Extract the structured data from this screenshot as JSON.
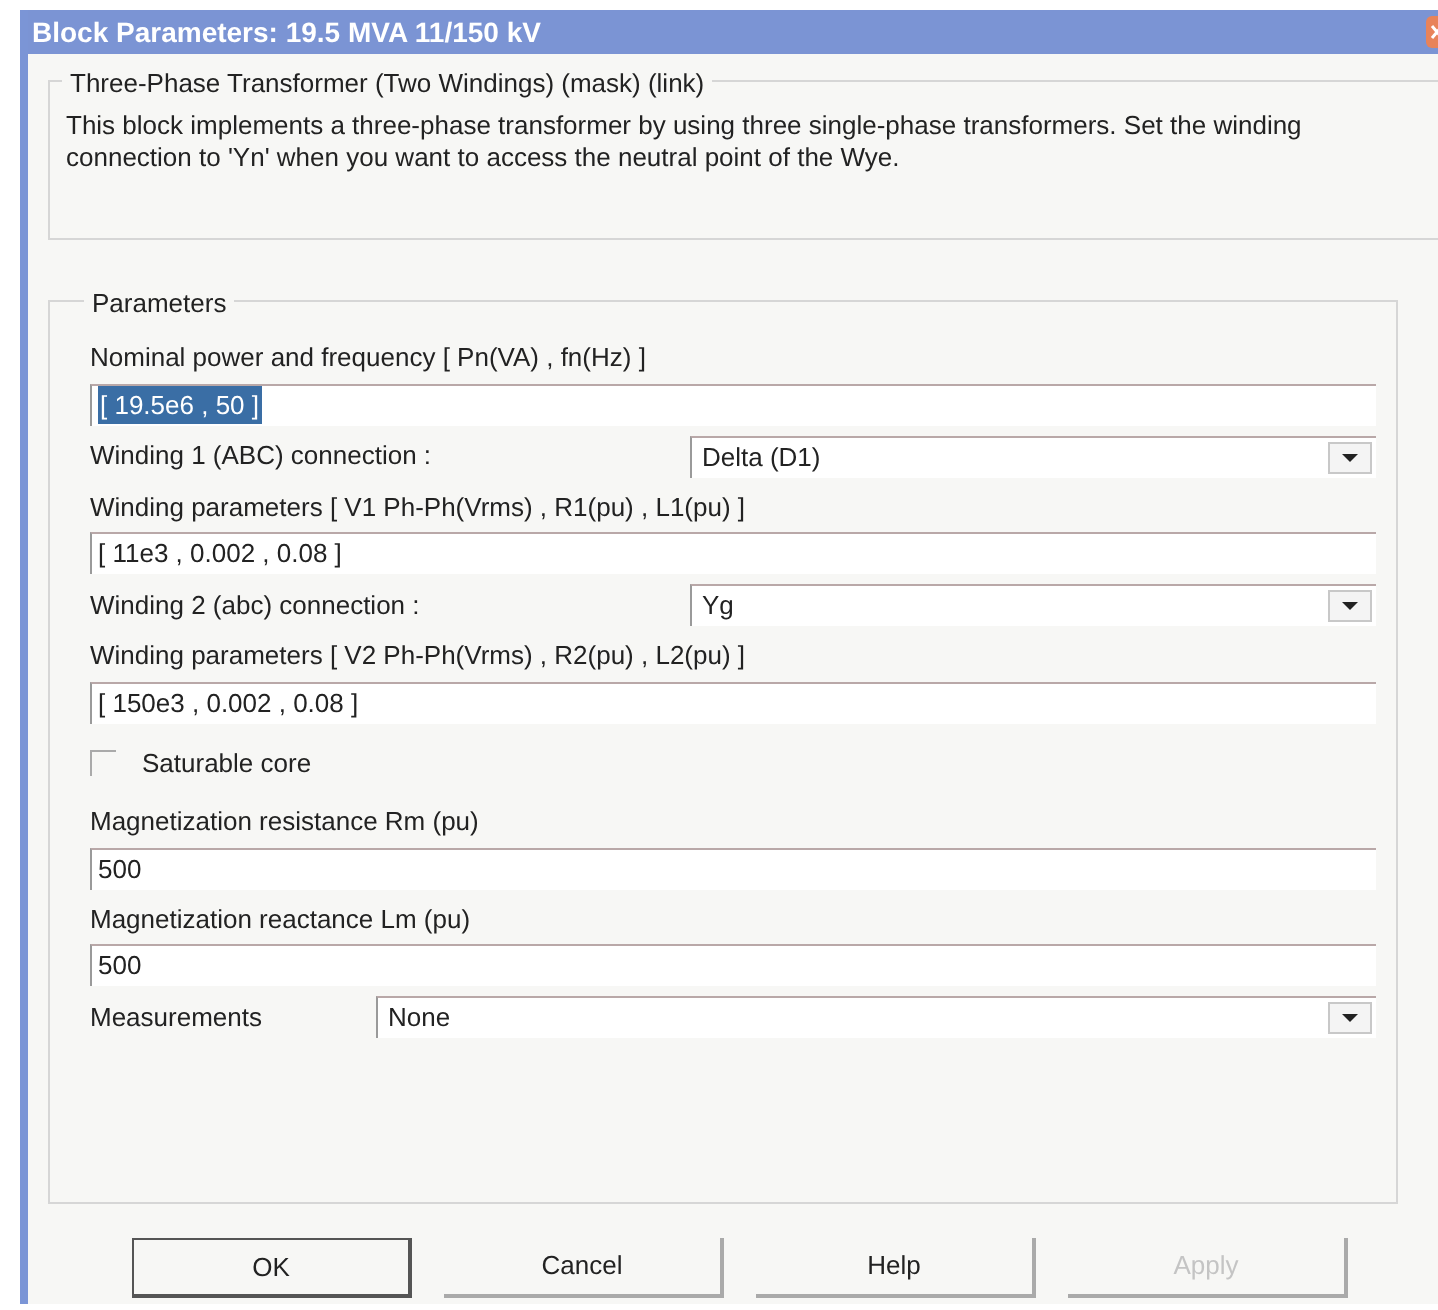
{
  "window": {
    "title": "Block Parameters: 19.5 MVA 11/150 kV"
  },
  "description": {
    "heading": "Three-Phase Transformer (Two Windings) (mask) (link)",
    "text": "This block implements a three-phase transformer by using three single-phase transformers. Set the winding connection to 'Yn'  when you want to access the neutral point of the Wye."
  },
  "parameters": {
    "heading": "Parameters",
    "fields": [
      {
        "kind": "text",
        "label": "Nominal power and frequency  [ Pn(VA) , fn(Hz) ]",
        "value": "[ 19.5e6 , 50 ]",
        "selected": true
      },
      {
        "kind": "dropdown",
        "label": "Winding 1 (ABC) connection :",
        "value": "Delta (D1)"
      },
      {
        "kind": "text",
        "label": "Winding parameters [ V1 Ph-Ph(Vrms) , R1(pu) , L1(pu) ]",
        "value": "[ 11e3 , 0.002 , 0.08 ]",
        "selected": false
      },
      {
        "kind": "dropdown",
        "label": "Winding 2 (abc) connection :",
        "value": "Yg"
      },
      {
        "kind": "text",
        "label": "Winding parameters [ V2 Ph-Ph(Vrms) , R2(pu) , L2(pu) ]",
        "value": "[ 150e3 , 0.002 , 0.08 ]",
        "selected": false
      },
      {
        "kind": "checkbox",
        "label": "Saturable core",
        "checked": false
      },
      {
        "kind": "text",
        "label": "Magnetization resistance  Rm (pu)",
        "value": "500",
        "selected": false
      },
      {
        "kind": "text",
        "label": "Magnetization reactance Lm (pu)",
        "value": "500",
        "selected": false
      },
      {
        "kind": "measure",
        "label": "Measurements",
        "value": "None"
      }
    ]
  },
  "buttons": [
    {
      "label": "OK",
      "disabled": false
    },
    {
      "label": "Cancel",
      "disabled": false
    },
    {
      "label": "Help",
      "disabled": false
    },
    {
      "label": "Apply",
      "disabled": true
    }
  ]
}
